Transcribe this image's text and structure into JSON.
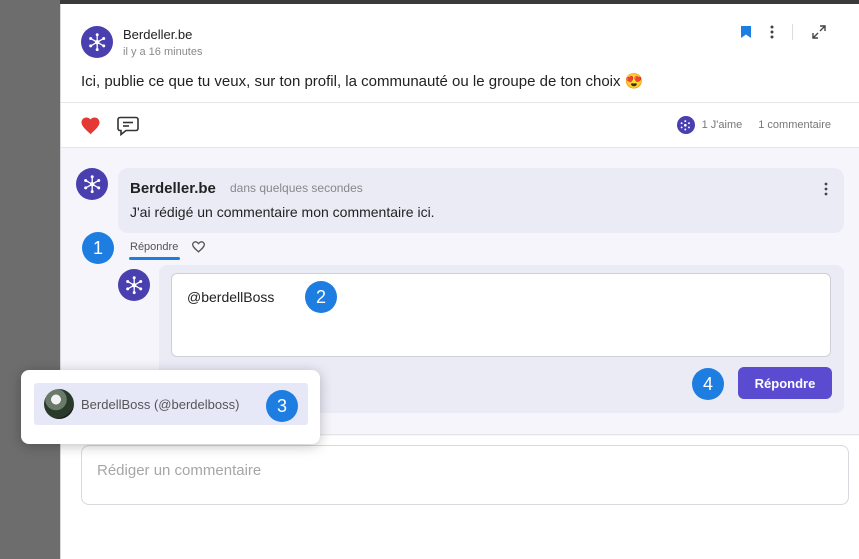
{
  "post": {
    "author": "Berdeller.be",
    "time": "il y a 16 minutes",
    "text": "Ici, publie ce que tu veux, sur ton profil, la communauté ou le groupe de ton choix 😍",
    "likes_label": "1 J'aime",
    "comments_label": "1 commentaire"
  },
  "comment": {
    "author": "Berdeller.be",
    "time": "dans quelques secondes",
    "text": "J'ai rédigé un commentaire mon commentaire ici.",
    "reply_link": "Répondre"
  },
  "reply": {
    "input_value": "@berdellBoss",
    "submit_label": "Répondre"
  },
  "mention_suggestion": {
    "label": "BerdellBoss (@berdelboss)"
  },
  "composer": {
    "placeholder": "Rédiger un commentaire"
  },
  "step_badges": [
    "1",
    "2",
    "3",
    "4"
  ],
  "colors": {
    "accent": "#5a4bd1",
    "badge": "#1e7de0",
    "heart": "#e53935",
    "bookmark": "#1e7de0",
    "avatar": "#4a3fae"
  }
}
